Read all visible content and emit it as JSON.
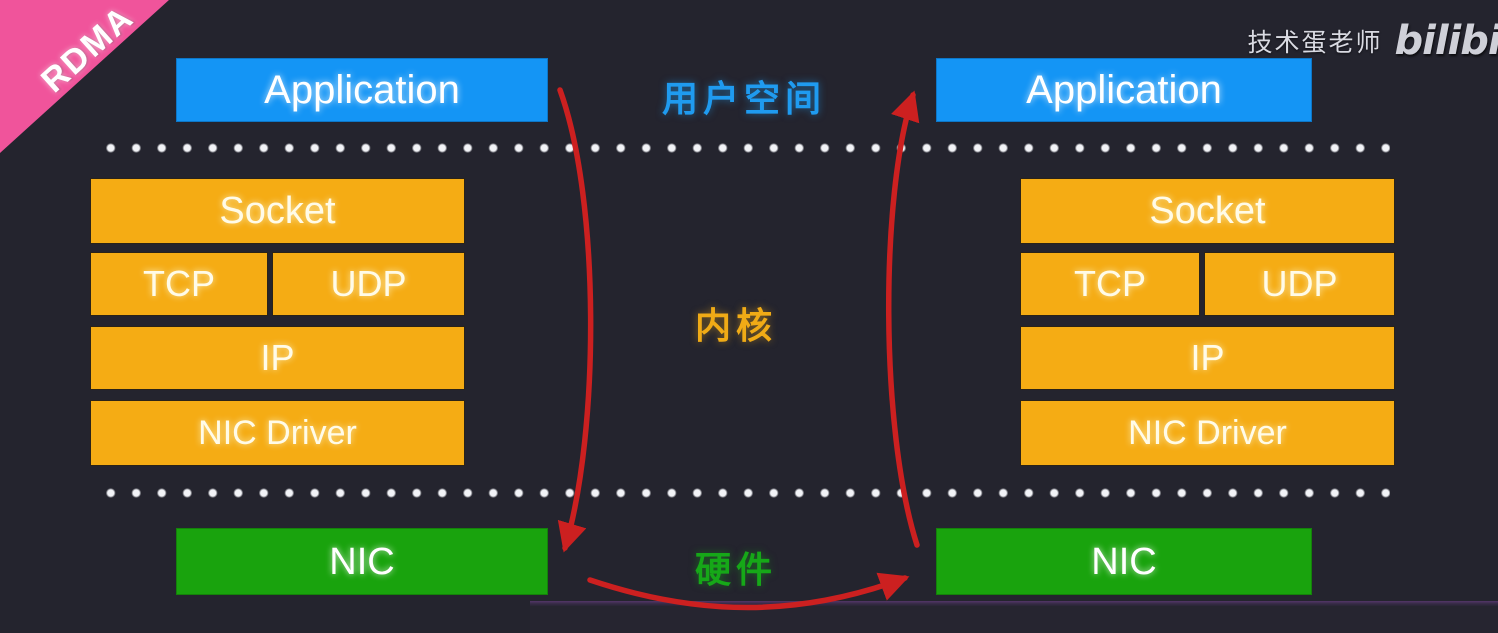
{
  "ribbon": {
    "label": "RDMA",
    "color": "#f0549b"
  },
  "watermark": {
    "author": "技术蛋老师",
    "logo": "bilibili"
  },
  "captions": {
    "user_space": "用户空间",
    "kernel": "内核",
    "hardware": "硬件"
  },
  "colors": {
    "background": "#24242e",
    "application": "#1495f5",
    "kernel_box": "#f5ac14",
    "nic": "#19a30d",
    "arrow": "#cc2020",
    "dot": "#f2f3f7",
    "user_space_text": "#1f9bf0",
    "kernel_text": "#f0ab16",
    "hardware_text": "#16a818"
  },
  "left_host": {
    "application": "Application",
    "socket": "Socket",
    "tcp": "TCP",
    "udp": "UDP",
    "ip": "IP",
    "nic_driver": "NIC Driver",
    "nic": "NIC"
  },
  "right_host": {
    "application": "Application",
    "socket": "Socket",
    "tcp": "TCP",
    "udp": "UDP",
    "ip": "IP",
    "nic_driver": "NIC Driver",
    "nic": "NIC"
  }
}
